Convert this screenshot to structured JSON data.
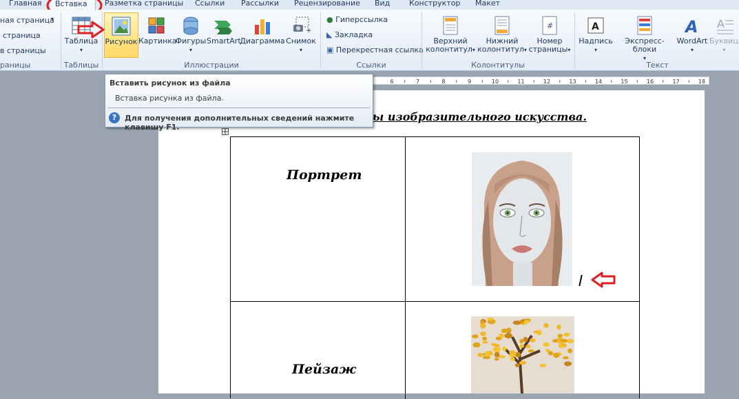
{
  "tabs": [
    {
      "label": "Главная"
    },
    {
      "label": "Вставка"
    },
    {
      "label": "Разметка страницы"
    },
    {
      "label": "Ссылки"
    },
    {
      "label": "Рассылки"
    },
    {
      "label": "Рецензирование"
    },
    {
      "label": "Вид"
    },
    {
      "label": "Конструктор"
    },
    {
      "label": "Макет"
    }
  ],
  "ribbon": {
    "pages_group": {
      "items": [
        "ная страница",
        "страница",
        "в страницы"
      ],
      "label": "раницы"
    },
    "tables_group": {
      "table_button": "Таблица",
      "label": "Таблицы"
    },
    "illustrations_group": {
      "picture": "Рисунок",
      "clipart": "Картинка",
      "shapes": "Фигуры",
      "smartart": "SmartArt",
      "chart": "Диаграмма",
      "screenshot": "Снимок",
      "label": "Иллюстрации"
    },
    "links_group": {
      "hyperlink": "Гиперссылка",
      "bookmark": "Закладка",
      "crossref": "Перекрестная ссылка",
      "label": "Ссылки"
    },
    "headers_group": {
      "header_1": "Верхний",
      "header_2": "колонтитул",
      "footer_1": "Нижний",
      "footer_2": "колонтитул",
      "pagenum_1": "Номер",
      "pagenum_2": "страницы",
      "label": "Колонтитулы"
    },
    "text_group": {
      "textbox": "Надпись",
      "quickparts": "Экспресс-блоки",
      "wordart": "WordArt",
      "dropcap": "Буквица",
      "label": "Текст"
    }
  },
  "tooltip": {
    "title": "Вставить рисунок из файла",
    "description": "Вставка рисунка из файла.",
    "help": "Для получения дополнительных сведений нажмите клавишу F1."
  },
  "ruler": {
    "marks": [
      "6",
      "7",
      "8",
      "9",
      "10",
      "11",
      "12",
      "13",
      "14",
      "15",
      "16",
      "17",
      "18"
    ]
  },
  "document": {
    "title_visible": "ы изобразительного искусства.",
    "rows": [
      {
        "label": "Портрет"
      },
      {
        "label": "Пейзаж"
      }
    ]
  },
  "colors": {
    "annotation": "#e02020",
    "ribbon_bg": "#e4ecf7",
    "accent": "#1e395b"
  }
}
